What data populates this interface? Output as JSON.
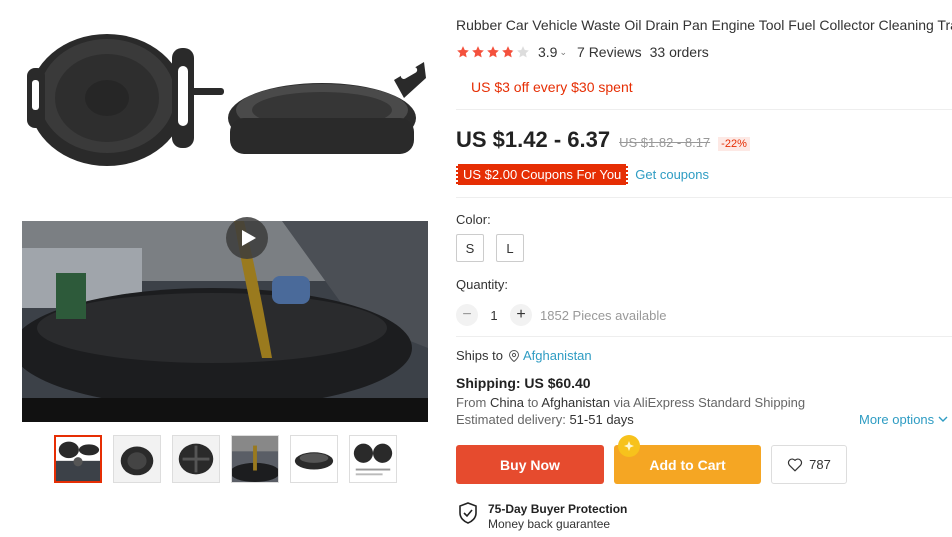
{
  "product": {
    "title": "Rubber Car Vehicle Waste Oil Drain Pan Engine Tool Fuel Collector Cleaning Tray",
    "rating": "3.9",
    "rating_stars": 3.9,
    "reviews": "7 Reviews",
    "orders": "33 orders",
    "promo": "US $3 off every $30 spent",
    "price": "US $1.42 - 6.37",
    "original_price": "US $1.82 - 8.17",
    "discount": "-22%",
    "coupon": "US $2.00 Coupons For You",
    "get_coupons": "Get coupons"
  },
  "sku": {
    "color_label": "Color:",
    "options": [
      "S",
      "L"
    ]
  },
  "quantity": {
    "label": "Quantity:",
    "minus": "−",
    "value": "1",
    "plus": "+",
    "available": "1852 Pieces available"
  },
  "shipping": {
    "ships_to_label": "Ships to",
    "country": "Afghanistan",
    "title": "Shipping: US $60.40",
    "from_prefix": "From",
    "from": "China",
    "to_word": "to",
    "to": "Afghanistan",
    "via_word": "via",
    "method": "AliExpress Standard Shipping",
    "delivery_label": "Estimated delivery:",
    "delivery_value": "51-51 days",
    "more_options": "More options"
  },
  "actions": {
    "buy_now": "Buy Now",
    "add_to_cart": "Add to Cart",
    "wishlist_count": "787"
  },
  "protection": {
    "title": "75-Day Buyer Protection",
    "subtitle": "Money back guarantee"
  },
  "colors": {
    "accent": "#e62e04",
    "buy": "#e64b2e",
    "cart": "#f5a623",
    "link": "#2e9cc3",
    "star": "#f4513d"
  },
  "icons": [
    "play-icon",
    "star-icon",
    "location-pin-icon",
    "chevron-down-icon",
    "heart-icon",
    "shield-check-icon",
    "coin-icon"
  ]
}
